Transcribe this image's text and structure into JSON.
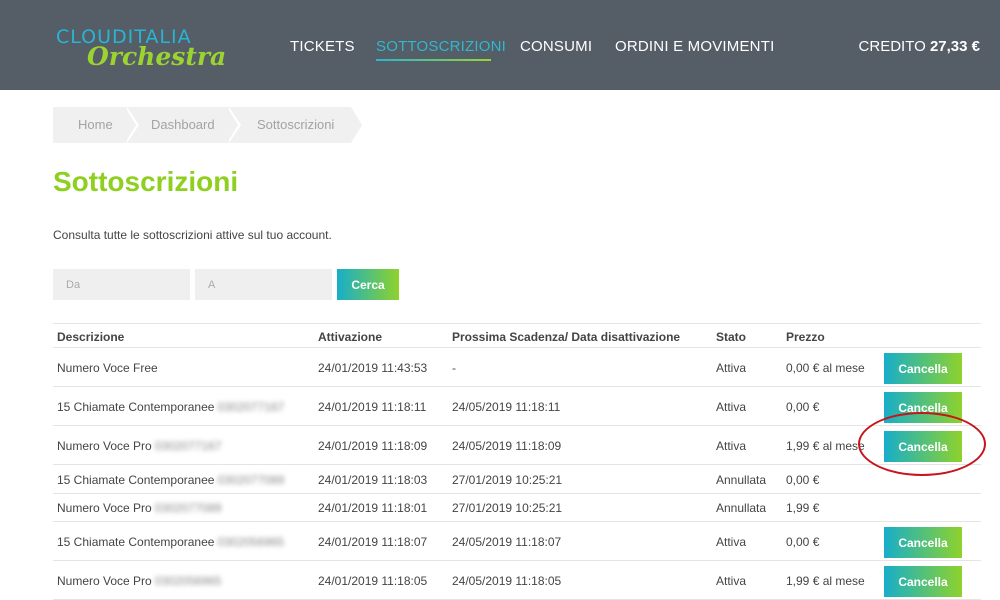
{
  "header": {
    "logo_top": "CLOUDITALIA",
    "logo_bottom": "Orchestra",
    "nav": [
      "TICKETS",
      "SOTTOSCRIZIONI",
      "CONSUMI",
      "ORDINI E MOVIMENTI"
    ],
    "active_nav": "SOTTOSCRIZIONI",
    "credit_label": "CREDITO",
    "credit_value": "27,33 €"
  },
  "breadcrumb": [
    "Home",
    "Dashboard",
    "Sottoscrizioni"
  ],
  "page": {
    "title": "Sottoscrizioni",
    "description": "Consulta tutte le sottoscrizioni attive sul tuo account."
  },
  "filters": {
    "from_placeholder": "Da",
    "to_placeholder": "A",
    "search_label": "Cerca"
  },
  "table": {
    "headers": [
      "Descrizione",
      "Attivazione",
      "Prossima Scadenza/ Data disattivazione",
      "Stato",
      "Prezzo"
    ],
    "action_label": "Cancella",
    "rows": [
      {
        "desc": "Numero Voce Free",
        "number": "",
        "activation": "24/01/2019 11:43:53",
        "expiry": "-",
        "status": "Attiva",
        "price": "0,00 € al mese",
        "cancellable": true
      },
      {
        "desc": "15 Chiamate Contemporanee",
        "number": "0302077167",
        "activation": "24/01/2019 11:18:11",
        "expiry": "24/05/2019 11:18:11",
        "status": "Attiva",
        "price": "0,00 €",
        "cancellable": true
      },
      {
        "desc": "Numero Voce Pro",
        "number": "0302077167",
        "activation": "24/01/2019 11:18:09",
        "expiry": "24/05/2019 11:18:09",
        "status": "Attiva",
        "price": "1,99 € al mese",
        "cancellable": true
      },
      {
        "desc": "15 Chiamate Contemporanee",
        "number": "0302077089",
        "activation": "24/01/2019 11:18:03",
        "expiry": "27/01/2019 10:25:21",
        "status": "Annullata",
        "price": "0,00 €",
        "cancellable": false
      },
      {
        "desc": "Numero Voce Pro",
        "number": "0302077089",
        "activation": "24/01/2019 11:18:01",
        "expiry": "27/01/2019 10:25:21",
        "status": "Annullata",
        "price": "1,99 €",
        "cancellable": false
      },
      {
        "desc": "15 Chiamate Contemporanee",
        "number": "0302056965",
        "activation": "24/01/2019 11:18:07",
        "expiry": "24/05/2019 11:18:07",
        "status": "Attiva",
        "price": "0,00 €",
        "cancellable": true
      },
      {
        "desc": "Numero Voce Pro",
        "number": "0302056965",
        "activation": "24/01/2019 11:18:05",
        "expiry": "24/05/2019 11:18:05",
        "status": "Attiva",
        "price": "1,99 € al mese",
        "cancellable": true
      }
    ]
  },
  "colors": {
    "header_bg": "#555d66",
    "accent_green": "#8ecf1f",
    "accent_blue": "#27b5d6",
    "highlight_circle": "#c4161c"
  }
}
